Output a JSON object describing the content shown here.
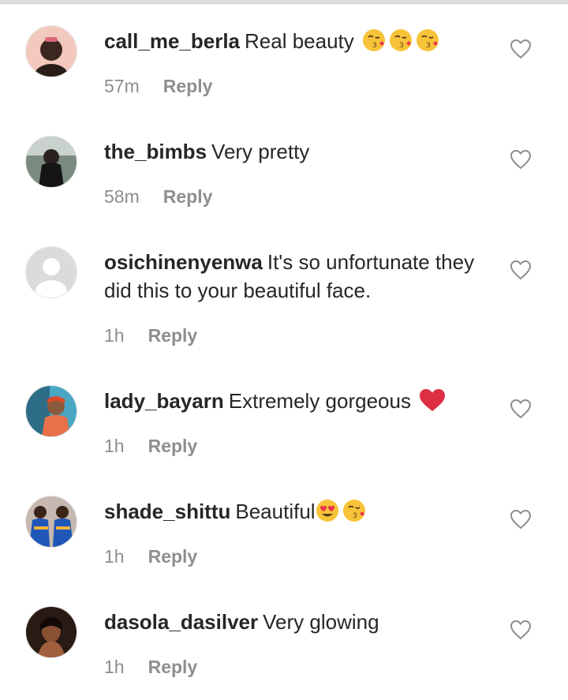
{
  "comments": [
    {
      "username": "call_me_berla",
      "text": "Real beauty",
      "emojis": [
        "kiss-emoji",
        "kiss-emoji",
        "kiss-emoji"
      ],
      "time": "57m",
      "reply": "Reply"
    },
    {
      "username": "the_bimbs",
      "text": "Very pretty",
      "emojis": [],
      "time": "58m",
      "reply": "Reply"
    },
    {
      "username": "osichinenyenwa",
      "text": "It's so unfortunate they did this to your beautiful face.",
      "emojis": [],
      "time": "1h",
      "reply": "Reply"
    },
    {
      "username": "lady_bayarn",
      "text": "Extremely gorgeous",
      "emojis": [
        "red-heart-emoji"
      ],
      "time": "1h",
      "reply": "Reply"
    },
    {
      "username": "shade_shittu",
      "text": "Beautiful",
      "emojis": [
        "heart-eyes-emoji",
        "kiss-emoji"
      ],
      "time": "1h",
      "reply": "Reply"
    },
    {
      "username": "dasola_dasilver",
      "text": "Very glowing",
      "emojis": [],
      "time": "1h",
      "reply": "Reply"
    }
  ],
  "colors": {
    "text": "#262626",
    "meta": "#8e8e8e",
    "heart_outline": "#8e8e8e",
    "red_heart": "#dd2e44",
    "emoji_yellow": "#f7c338"
  }
}
